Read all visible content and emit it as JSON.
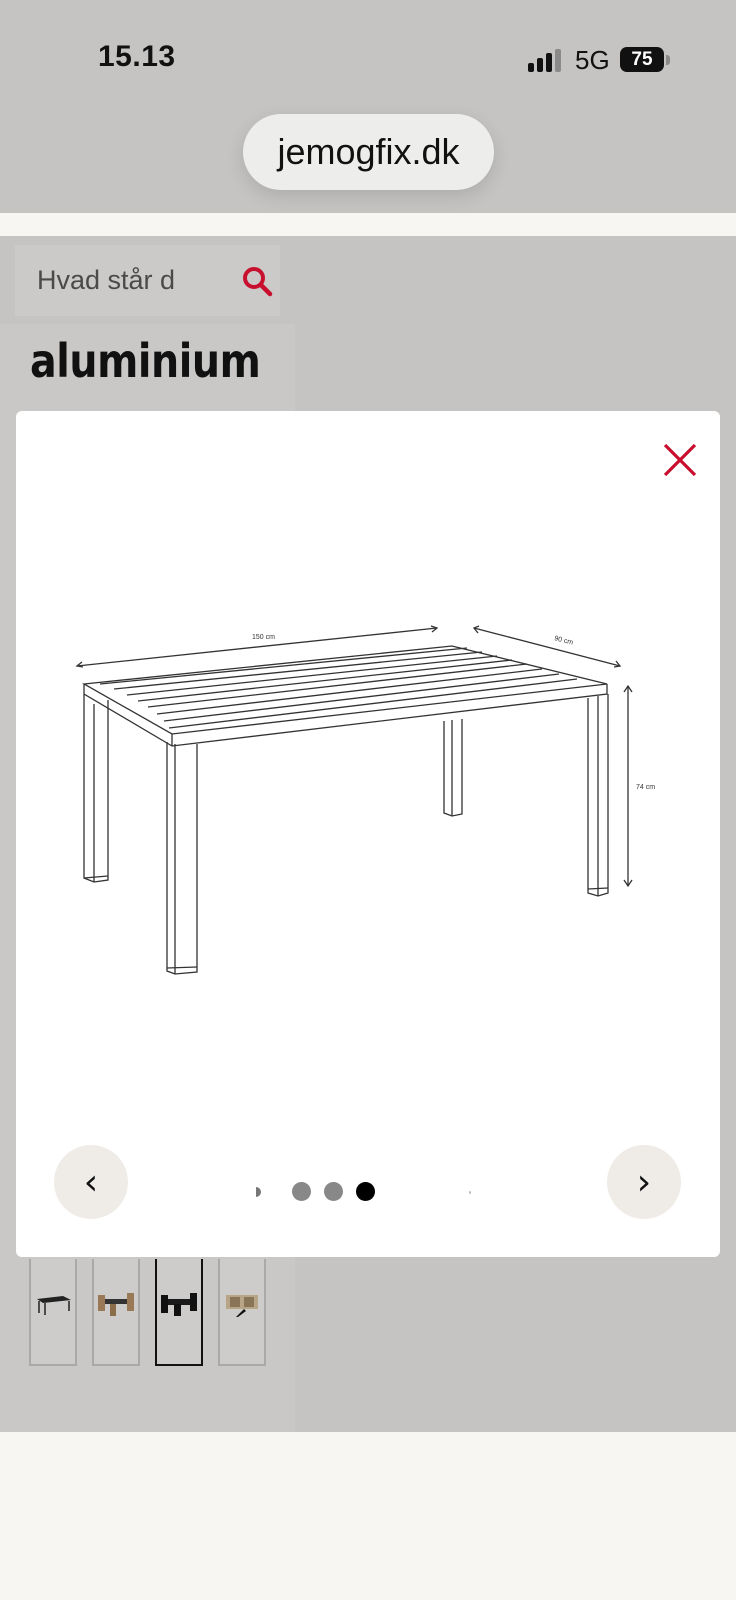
{
  "status_bar": {
    "time": "15.13",
    "network": "5G",
    "battery": "75"
  },
  "browser": {
    "url": "jemogfix.dk"
  },
  "search": {
    "placeholder": "Hvad står d",
    "icon": "search-icon"
  },
  "page": {
    "heading": "aluminium"
  },
  "gallery_modal": {
    "close_icon": "close-icon",
    "image": {
      "description_icon": "table-line-drawing",
      "dimensions": {
        "length": "150 cm",
        "width": "90 cm",
        "height": "74 cm"
      }
    },
    "prev_label": "‹",
    "next_label": "›",
    "total_dots": 6,
    "active_dot": 4
  },
  "thumbnails": [
    {
      "name": "thumb-table",
      "active": false
    },
    {
      "name": "thumb-set-wood",
      "active": false
    },
    {
      "name": "thumb-set-black",
      "active": true
    },
    {
      "name": "thumb-set-rattan",
      "active": false
    }
  ],
  "colors": {
    "accent_red": "#c8102e",
    "dim_overlay": "#c5c4c2",
    "modal_bg": "#ffffff"
  }
}
